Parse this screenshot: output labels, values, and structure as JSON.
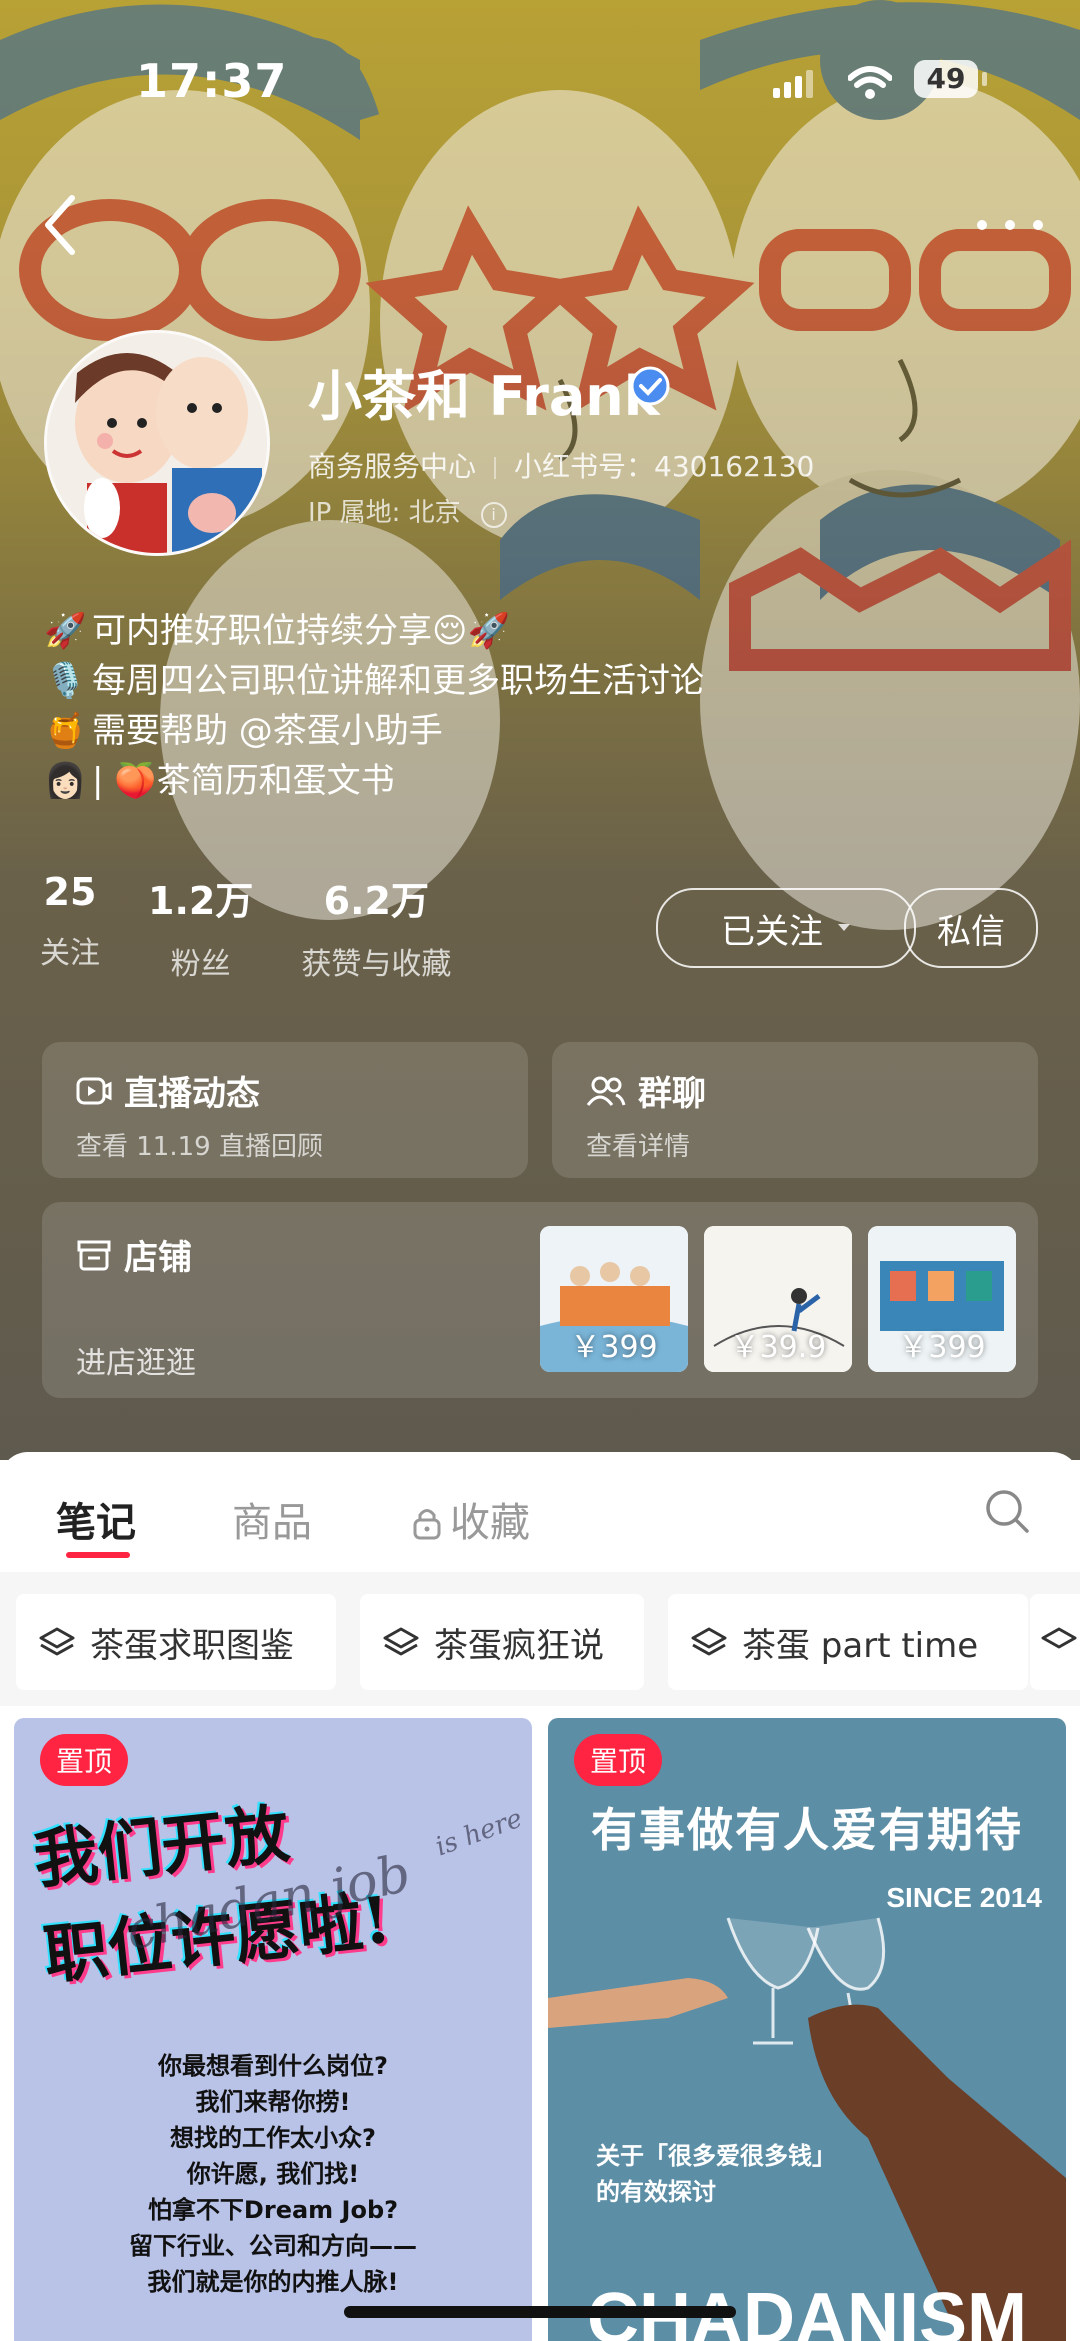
{
  "status_bar": {
    "time": "17:37",
    "battery": "49"
  },
  "profile": {
    "name": "小茶和 Frank",
    "category": "商务服务中心",
    "red_id": "小红书号：430162130",
    "ip": "IP 属地: 北京"
  },
  "bio": [
    {
      "icon": "🚀",
      "text": "可内推好职位持续分享😌🚀"
    },
    {
      "icon": "🎙️",
      "text": "每周四公司职位讲解和更多职场生活讨论"
    },
    {
      "icon": "🍯",
      "text": "需要帮助 @茶蛋小助手"
    },
    {
      "icon": "👩🏻",
      "text": "| 🍑茶简历和蛋文书"
    }
  ],
  "stats": [
    {
      "num": "25",
      "label": "关注"
    },
    {
      "num": "1.2万",
      "label": "粉丝"
    },
    {
      "num": "6.2万",
      "label": "获赞与收藏"
    }
  ],
  "actions": {
    "follow": "已关注",
    "message": "私信"
  },
  "cards": {
    "live": {
      "title": "直播动态",
      "sub": "查看 11.19 直播回顾"
    },
    "group": {
      "title": "群聊",
      "sub": "查看详情"
    },
    "shop": {
      "title": "店铺",
      "sub": "进店逛逛",
      "items": [
        {
          "price": "￥399"
        },
        {
          "price": "￥39.9"
        },
        {
          "price": "￥399"
        }
      ]
    }
  },
  "tabs": [
    "笔记",
    "商品",
    "收藏"
  ],
  "collections": [
    "茶蛋求职图鉴",
    "茶蛋疯狂说",
    "茶蛋 part time"
  ],
  "notes": [
    {
      "badge": "置顶",
      "title_line1": "我们开放",
      "title_line2": "职位许愿啦!",
      "script": "chadan job",
      "script2": "is here",
      "body": [
        "你最想看到什么岗位?",
        "我们来帮你捞!",
        "想找的工作太小众?",
        "你许愿, 我们找!",
        "怕拿不下Dream Job?",
        "留下行业、公司和方向——",
        "我们就是你的内推人脉!"
      ]
    },
    {
      "badge": "置顶",
      "title": "有事做有人爱有期待",
      "since": "SINCE 2014",
      "caption1": "关于「很多爱很多钱」",
      "caption2": "的有效探讨",
      "footer": "CHADANISM"
    }
  ],
  "colors": {
    "accent": "#ff2442",
    "verified": "#4a8cf0"
  }
}
